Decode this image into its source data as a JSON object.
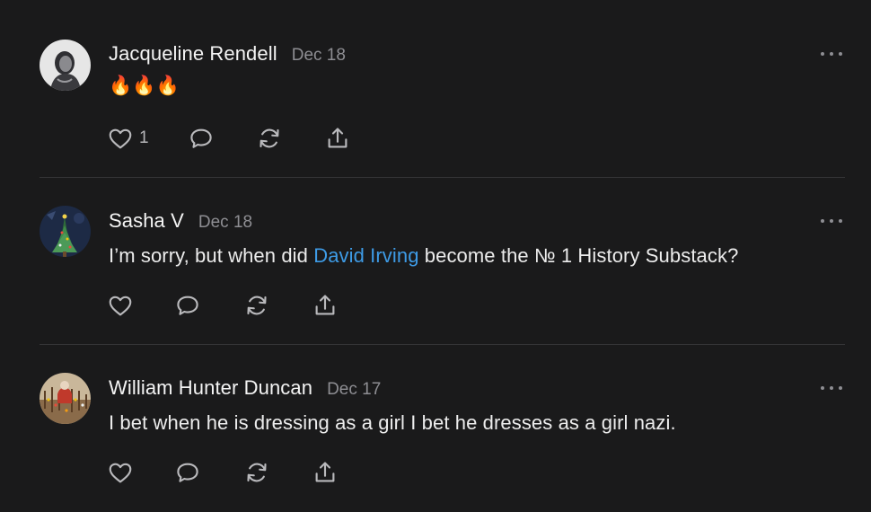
{
  "comments": [
    {
      "author": "Jacqueline Rendell",
      "date": "Dec 18",
      "text": "🔥🔥🔥",
      "like_count": "1",
      "avatar_icon": "portrait-avatar-grey"
    },
    {
      "author": "Sasha V",
      "date": "Dec 18",
      "text_before": "I’m sorry, but when did ",
      "link_text": "David Irving",
      "text_after": " become the № 1 History Substack?",
      "avatar_icon": "christmas-tree-avatar"
    },
    {
      "author": "William Hunter Duncan",
      "date": "Dec 17",
      "text": "I bet when he is dressing as a girl I bet he dresses as a girl nazi.",
      "avatar_icon": "holiday-lights-avatar"
    }
  ],
  "icons": {
    "like": "heart-icon",
    "reply": "speech-bubble-icon",
    "restack": "restack-icon",
    "share": "share-icon",
    "more": "more-options-icon"
  },
  "colors": {
    "background": "#1a1a1b",
    "link": "#3e9be6",
    "muted": "#8e8e93",
    "divider": "#353537"
  }
}
